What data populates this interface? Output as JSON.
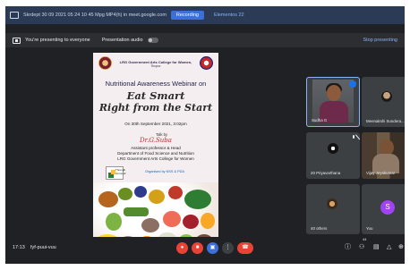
{
  "window": {
    "doc_title": "Skrdept 30 09 2021 05 24 10 45 Mpg MP4(h) in meet.google.com",
    "tabs": [
      "Recording",
      "Elementos 22"
    ]
  },
  "presenting_bar": {
    "status": "You're presenting to everyone",
    "audio_label": "Presentation audio",
    "stop_label": "Stop presenting"
  },
  "slide": {
    "college_name": "LRG Government Arts College for Women,",
    "college_place": "Tirupur",
    "webinar_title": "Nutritional Awareness Webinar on",
    "tagline_1": "Eat Smart",
    "tagline_2": "Right from the Start",
    "date": "On 30th September 2021, 3:02pm",
    "talk_by": "Talk by",
    "speaker": "Dr.G.Suba",
    "role_1": "Assistant professor & Head",
    "role_2": "Department of Food Science and Nutrition",
    "role_3": "LRG Government Arts College for Women",
    "through_text": "Through Gurunell",
    "organised_by": "Organised by NSS & PDA"
  },
  "participants": [
    {
      "name": "Sudha G",
      "speaking": true
    },
    {
      "name": "Meenakshi Sundera..."
    },
    {
      "name": "20 Priyavarthana"
    },
    {
      "name": "Vijay Jeyakumar"
    },
    {
      "name": "40 others"
    },
    {
      "name": "You",
      "avatar_letter": "S",
      "avatar_color": "#a142f4"
    }
  ],
  "bottom_bar": {
    "time": "17:13",
    "meeting_code": "fyf-puui-vuu",
    "people_count": "44",
    "controls": [
      "mic-off",
      "camera-off",
      "present",
      "more-options",
      "leave-call"
    ],
    "right_icons": [
      "info-icon",
      "people-icon",
      "chat-icon",
      "activities-icon",
      "lock-icon"
    ]
  },
  "colors": {
    "meet_bg": "#202124",
    "tile_bg": "#3c4043",
    "accent_blue": "#8ab4f8",
    "danger_red": "#ea4335",
    "speaker_red": "#c62828"
  }
}
